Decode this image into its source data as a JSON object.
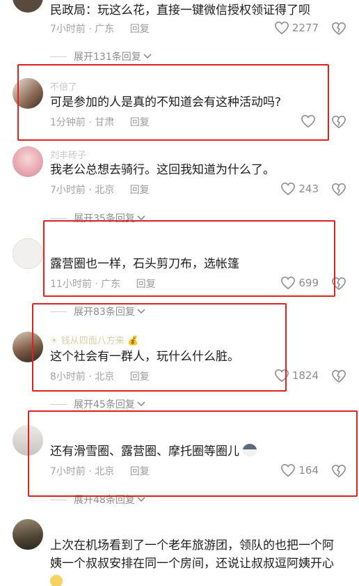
{
  "comments": [
    {
      "text": "民政局：玩这么花，直接一键微信授权领证得了呗",
      "time": "7小时前",
      "location": "广东",
      "reply_label": "回复",
      "likes": "2277"
    },
    {
      "username": "不倍了",
      "text": "可是参加的人是真的不知道会有这种活动吗?",
      "time": "1分钟前",
      "location": "甘肃",
      "reply_label": "回复",
      "likes": ""
    },
    {
      "username": "刘丰砖子",
      "text": "我老公总想去骑行。这回我知道为什么了。",
      "time": "7小时前",
      "location": "北京",
      "reply_label": "回复",
      "likes": "243"
    },
    {
      "username": "",
      "text": "露营圈也一样，石头剪刀布，选帐篷",
      "time": "11小时前",
      "location": "广东",
      "reply_label": "回复",
      "likes": "699"
    },
    {
      "username": "钱从四面八方来",
      "text": "这个社会有一群人，玩什么什么脏。",
      "time": "8小时前",
      "location": "北京",
      "reply_label": "回复",
      "likes": "1824"
    },
    {
      "username": "",
      "text": "还有滑雪圈、露营圈、摩托圈等圈儿",
      "time": "7小时前",
      "location": "北京",
      "reply_label": "回复",
      "likes": "164"
    },
    {
      "username": "",
      "text": "上次在机场看到了一个老年旅游团，领队的也把一个阿姨一个叔叔安排在同一个房间，还说让叔叔逗阿姨开心",
      "time": "",
      "location": "",
      "reply_label": "",
      "likes": ""
    }
  ],
  "expanders": [
    {
      "label": "展开131条回复"
    },
    {
      "label": "展开35条回复"
    },
    {
      "label": "展开83条回复"
    },
    {
      "label": "展开45条回复"
    },
    {
      "label": "展开48条回复"
    }
  ],
  "meta_separator": "·",
  "colors": {
    "highlight_box": "#e0201e",
    "meta_text": "#a3a3a3",
    "body_text": "#1c1c1c"
  },
  "icons": [
    "heart-outline-icon",
    "broken-heart-icon",
    "chevron-down-icon",
    "money-bag-emoji",
    "husky-emoji",
    "smile-emoji"
  ]
}
